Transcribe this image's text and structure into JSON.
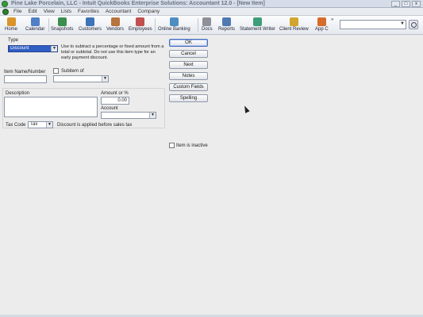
{
  "window": {
    "title": "Pine Lake Porcelain, LLC - Intuit QuickBooks Enterprise Solutions: Accountant 12.0 - [New Item]",
    "minimize_glyph": "_",
    "restore_glyph": "□",
    "close_glyph": "x"
  },
  "menu": {
    "items": [
      "File",
      "Edit",
      "View",
      "Lists",
      "Favorites",
      "Accountant",
      "Company"
    ]
  },
  "toolbar": {
    "buttons": [
      {
        "label": "Home",
        "icon": "home-icon",
        "color": "#d9942a"
      },
      {
        "label": "Calendar",
        "icon": "calendar-icon",
        "color": "#4f7fc8"
      },
      {
        "label": "Snapshots",
        "icon": "snapshots-icon",
        "color": "#3b8e4c"
      },
      {
        "label": "Customers",
        "icon": "customers-icon",
        "color": "#3d73b8"
      },
      {
        "label": "Vendors",
        "icon": "vendors-icon",
        "color": "#b8743d"
      },
      {
        "label": "Employees",
        "icon": "employees-icon",
        "color": "#c24e4e"
      },
      {
        "label": "Online Banking",
        "icon": "online-banking-icon",
        "color": "#4e8dc2"
      },
      {
        "label": "Docs",
        "icon": "docs-icon",
        "color": "#8d8f99"
      },
      {
        "label": "Reports",
        "icon": "reports-icon",
        "color": "#4f79b3"
      },
      {
        "label": "Statement Writer",
        "icon": "statement-writer-icon",
        "color": "#3f9e7a"
      },
      {
        "label": "Client Review",
        "icon": "client-review-icon",
        "color": "#d1a52d"
      },
      {
        "label": "App C",
        "icon": "app-center-icon",
        "color": "#d66c2a"
      }
    ],
    "more_glyph": "»",
    "search_value": "",
    "search_arrow": "▼"
  },
  "form": {
    "type_label": "Type",
    "type_value": "Discount",
    "type_help": "Use to subtract a percentage or fixed amount from a total or subtotal. Do not use this item type for an early payment discount.",
    "item_name_label": "Item Name/Number",
    "item_name_value": "",
    "subitem_label": "Subitem of",
    "subitem_value": "",
    "description_label": "Description",
    "description_value": "",
    "amount_label": "Amount or %",
    "amount_value": "0.00",
    "account_label": "Account",
    "account_value": "",
    "tax_code_label": "Tax Code",
    "tax_code_value": "Tax",
    "tax_note": "Discount is applied before sales tax",
    "inactive_label": "Item is inactive",
    "dropdown_glyph": "▼"
  },
  "buttons": {
    "ok": "OK",
    "cancel": "Cancel",
    "next": "Next",
    "notes": "Notes",
    "custom_fields": "Custom Fields",
    "spelling": "Spelling"
  }
}
